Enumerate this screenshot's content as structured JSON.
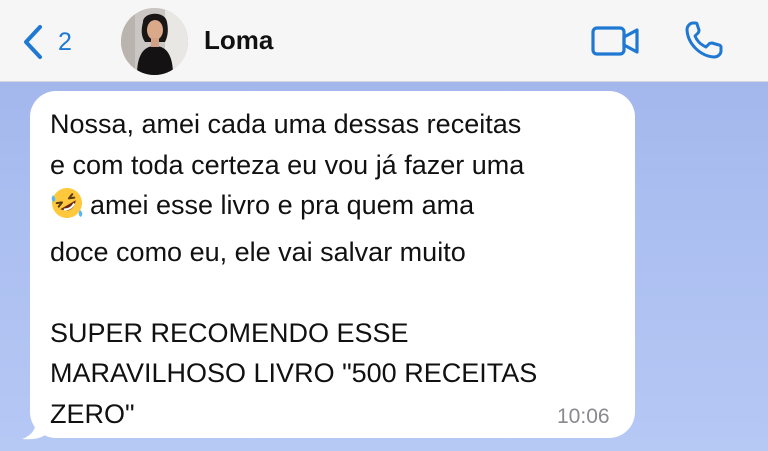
{
  "header": {
    "back_icon": "chevron-left-icon",
    "back_count": "2",
    "contact_name": "Loma",
    "video_icon": "video-camera-icon",
    "call_icon": "phone-icon",
    "accent_color": "#1f78d1"
  },
  "message": {
    "lines": [
      "Nossa, amei cada uma dessas receitas",
      "e com toda certeza eu vou já fazer uma",
      "amei esse livro e pra quem ama",
      "doce como eu, ele vai salvar muito",
      "SUPER RECOMENDO ESSE",
      "MARAVILHOSO LIVRO \"500 RECEITAS",
      "ZERO\""
    ],
    "emoji": "rolling-on-the-floor-laughing-emoji",
    "time": "10:06"
  }
}
